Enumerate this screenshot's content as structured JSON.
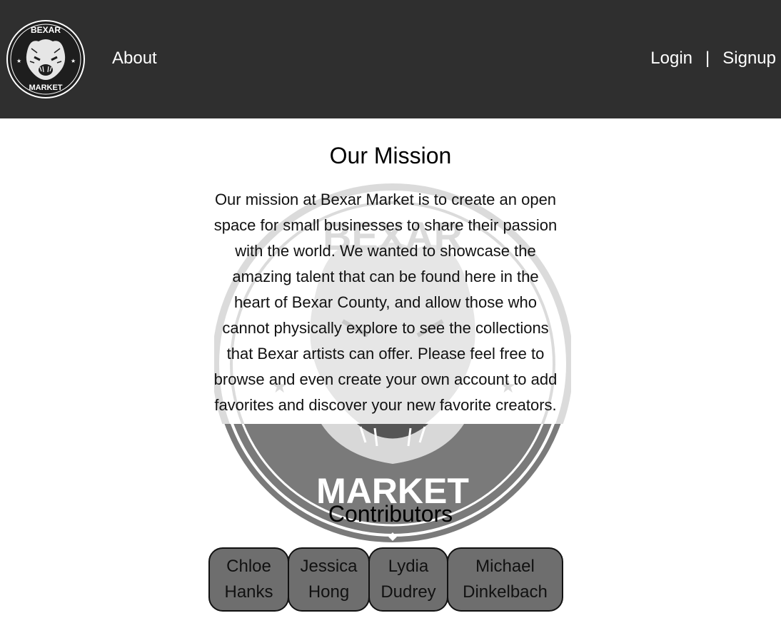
{
  "header": {
    "logo": {
      "top_text": "BEXAR",
      "bottom_text": "MARKET",
      "icon": "bear-icon"
    },
    "nav_about": "About",
    "login": "Login",
    "separator": "|",
    "signup": "Signup"
  },
  "mission": {
    "title": "Our Mission",
    "lines": [
      "Our mission at Bexar Market is to create an open",
      "space for small businesses to share their passion",
      "with the world. We wanted to showcase the",
      "amazing talent that can be found here in the",
      "heart of Bexar County, and allow those who",
      "cannot physically explore to see the collections",
      "that Bexar artists can offer. Please feel free to",
      "browse and even create your own account to add",
      "favorites and discover your new favorite creators."
    ]
  },
  "watermark": {
    "top_text": "BEXAR",
    "bottom_text": "MARKET"
  },
  "contributors": {
    "title": "Contributors",
    "people": [
      {
        "first": "Chloe",
        "last": "Hanks"
      },
      {
        "first": "Jessica",
        "last": "Hong"
      },
      {
        "first": "Lydia",
        "last": "Dudrey"
      },
      {
        "first": "Michael",
        "last": "Dinkelbach"
      }
    ]
  },
  "colors": {
    "header_bg": "#2f2f2f",
    "card_bg": "#6e6e6e",
    "watermark_gray": "#7a7a7a"
  }
}
